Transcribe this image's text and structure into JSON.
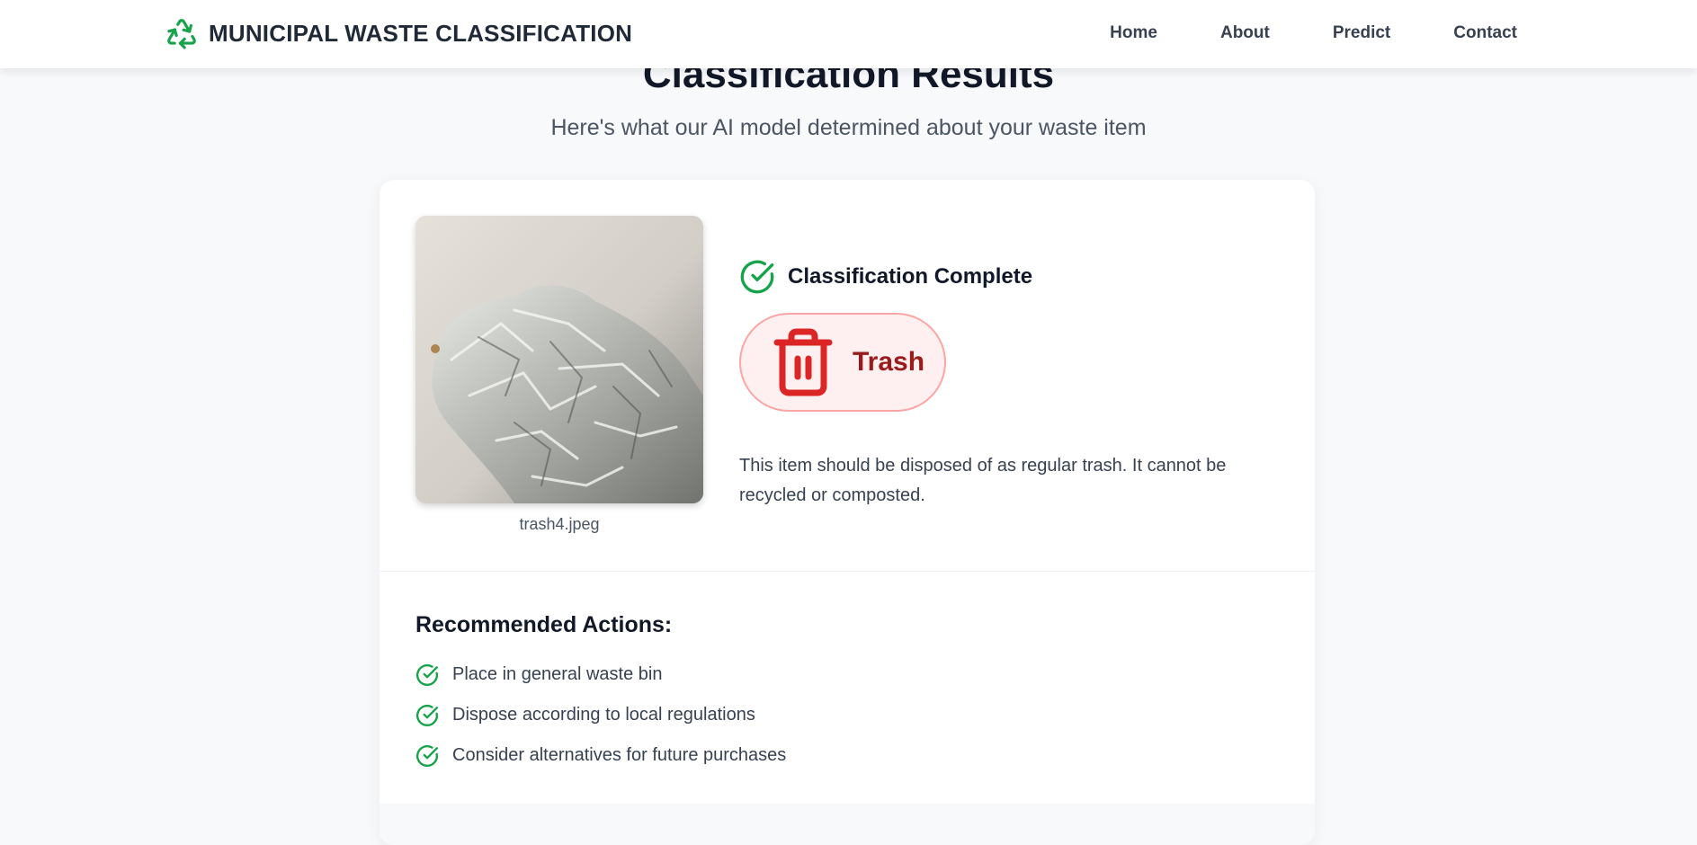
{
  "header": {
    "logo_icon": "recycle-icon",
    "title": "MUNICIPAL WASTE CLASSIFICATION",
    "nav": [
      {
        "label": "Home"
      },
      {
        "label": "About"
      },
      {
        "label": "Predict"
      },
      {
        "label": "Contact"
      }
    ]
  },
  "page": {
    "title": "Classification Results",
    "subtitle": "Here's what our AI model determined about your waste item"
  },
  "result": {
    "image_alt_icon": "uploaded-photo",
    "file_name": "trash4.jpeg",
    "status_icon": "check-circle-icon",
    "status": "Classification Complete",
    "category_icon": "trash-bin-icon",
    "category": "Trash",
    "description": "This item should be disposed of as regular trash. It cannot be recycled or composted."
  },
  "actions": {
    "title": "Recommended Actions:",
    "items": [
      {
        "label": "Place in general waste bin"
      },
      {
        "label": "Dispose according to local regulations"
      },
      {
        "label": "Consider alternatives for future purchases"
      }
    ]
  },
  "colors": {
    "accent_green": "#16a34a",
    "trash_red": "#dc2626",
    "trash_text": "#991b1b",
    "badge_bg": "#fef0f0",
    "badge_border": "#fca5a5"
  }
}
